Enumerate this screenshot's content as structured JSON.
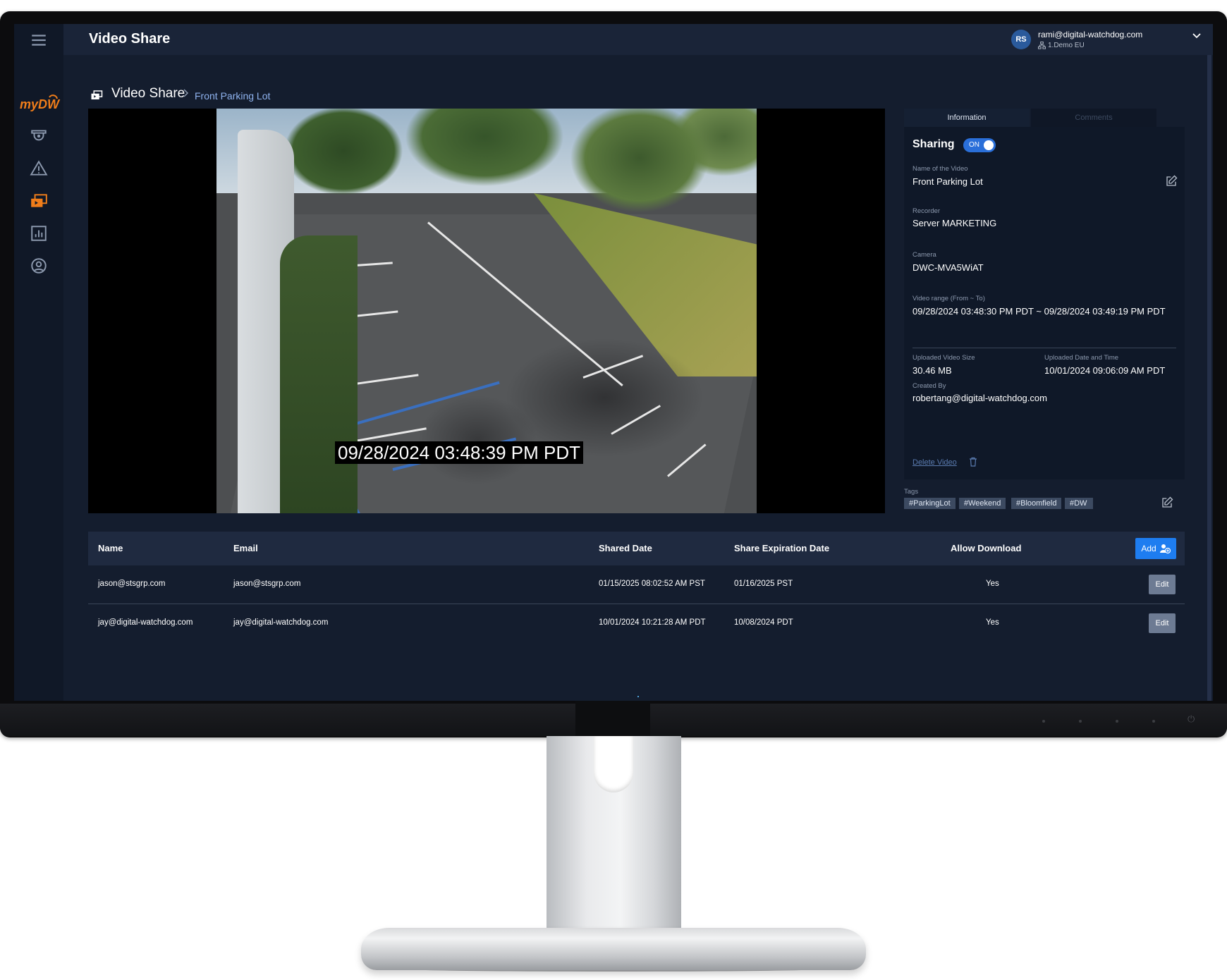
{
  "app": {
    "title": "Video Share"
  },
  "user": {
    "initials": "RS",
    "email": "rami@digital-watchdog.com",
    "org": "1.Demo EU"
  },
  "sidebar": {
    "logo_text": "myDW",
    "items": [
      {
        "name": "cameras",
        "icon": "security-camera-icon"
      },
      {
        "name": "alerts",
        "icon": "warning-icon"
      },
      {
        "name": "video-share",
        "icon": "video-share-icon",
        "active": true
      },
      {
        "name": "reports",
        "icon": "report-chart-icon"
      },
      {
        "name": "account",
        "icon": "user-circle-icon"
      }
    ]
  },
  "breadcrumb": {
    "title": "Video Share",
    "current": "Front Parking Lot"
  },
  "video": {
    "timestamp": "09/28/2024 03:48:39 PM PDT"
  },
  "info": {
    "tabs": [
      {
        "label": "Information",
        "active": true
      },
      {
        "label": "Comments",
        "active": false
      }
    ],
    "sharing_label": "Sharing",
    "sharing_toggle": "ON",
    "name_label": "Name of the Video",
    "name_value": "Front Parking Lot",
    "recorder_label": "Recorder",
    "recorder_value": "Server MARKETING",
    "camera_label": "Camera",
    "camera_value": "DWC-MVA5WiAT",
    "range_label": "Video range (From ~ To)",
    "range_value": "09/28/2024 03:48:30 PM PDT ~ 09/28/2024 03:49:19 PM PDT",
    "size_label": "Uploaded Video Size",
    "size_value": "30.46 MB",
    "uploaded_label": "Uploaded Date and Time",
    "uploaded_value": "10/01/2024 09:06:09 AM PDT",
    "created_label": "Created By",
    "created_value": "robertang@digital-watchdog.com",
    "delete_label": "Delete Video"
  },
  "tags": {
    "label": "Tags",
    "items": [
      "#ParkingLot",
      "#Weekend",
      "#Bloomfield",
      "#DW"
    ]
  },
  "table": {
    "headers": [
      "Name",
      "Email",
      "Shared Date",
      "Share Expiration Date",
      "Allow Download"
    ],
    "add_label": "Add",
    "edit_label": "Edit",
    "rows": [
      {
        "name": "jason@stsgrp.com",
        "email": "jason@stsgrp.com",
        "shared": "01/15/2025 08:02:52 AM PST",
        "expires": "01/16/2025 PST",
        "download": "Yes"
      },
      {
        "name": "jay@digital-watchdog.com",
        "email": "jay@digital-watchdog.com",
        "shared": "10/01/2024 10:21:28 AM PDT",
        "expires": "10/08/2024 PDT",
        "download": "Yes"
      }
    ]
  },
  "colors": {
    "accent": "#1e7df0",
    "brand": "#f07d1a",
    "background": "#141d2e"
  }
}
